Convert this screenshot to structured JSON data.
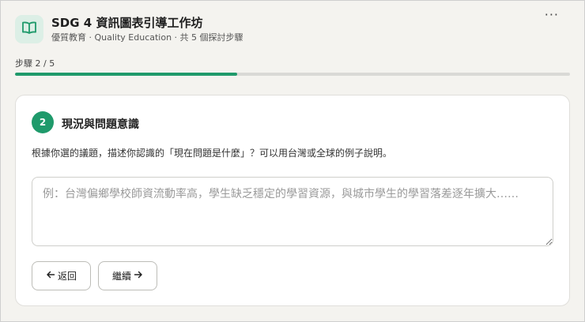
{
  "header": {
    "title": "SDG 4 資訊圖表引導工作坊",
    "subtitle": "優質教育 · Quality Education · 共 5 個探討步驟",
    "logo_icon": "open-book-icon",
    "more_label": "···"
  },
  "progress": {
    "label": "步驟 2 / 5",
    "current": 2,
    "total": 5,
    "fraction": 0.4,
    "color": "#1f9a6b"
  },
  "step": {
    "number": "2",
    "title": "現況與問題意識",
    "prompt": "根據你選的議題，描述你認識的「現在問題是什麼」？可以用台灣或全球的例子說明。",
    "answer_value": "",
    "answer_placeholder": "例：台灣偏鄉學校師資流動率高，學生缺乏穩定的學習資源，與城市學生的學習落差逐年擴大……"
  },
  "actions": {
    "back_label": "返回",
    "back_icon": "arrow-left-icon",
    "next_label": "繼續",
    "next_icon": "arrow-right-icon"
  }
}
